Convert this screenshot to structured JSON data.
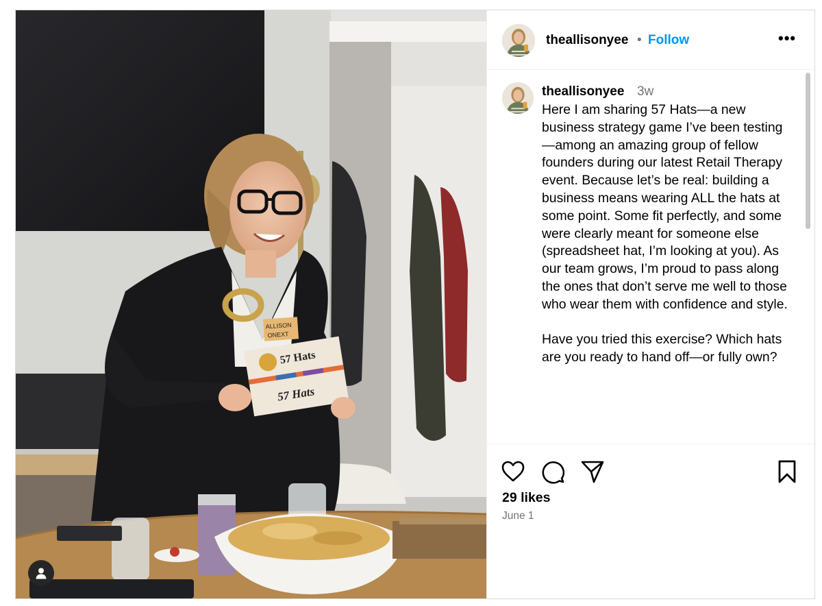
{
  "post": {
    "username": "theallisonyee",
    "follow_label": "Follow",
    "separator": "•",
    "more_label": "•••",
    "caption": {
      "username": "theallisonyee",
      "time": "3w",
      "text": "Here I am sharing 57 Hats—a new business strategy game I’ve been testing—among an amazing group of fellow founders during our latest Retail Therapy event. Because let’s be real: building a business means wearing ALL the hats at some point. Some fit perfectly, and some were clearly meant for someone else (spreadsheet hat, I’m looking at you). As our team grows, I’m proud to pass along the ones that don’t serve me well to those who wear them with confidence and style.\n\nHave you tried this exercise? Which hats are you ready to hand off—or fully own?"
    },
    "likes": "29 likes",
    "date": "June 1",
    "photo": {
      "box_title": "57 Hats",
      "name_tag": "ALLISON",
      "name_tag_2": "ONEXT"
    },
    "icons": {
      "like": "heart-icon",
      "comment": "comment-icon",
      "share": "share-icon",
      "save": "bookmark-icon",
      "tag": "user-tag-icon",
      "more": "more-options-icon"
    },
    "colors": {
      "follow": "#0095f6",
      "secondary_text": "#737373"
    }
  }
}
